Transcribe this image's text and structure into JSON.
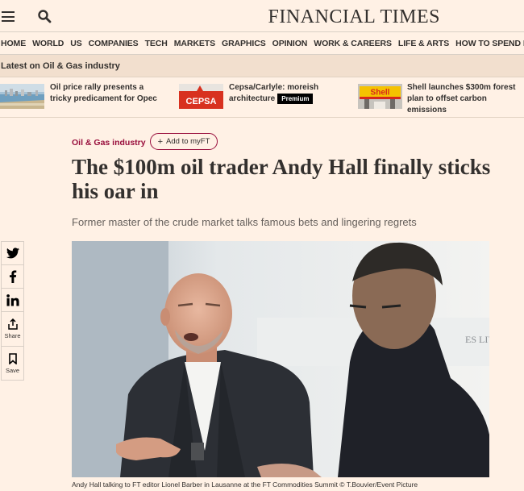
{
  "header": {
    "masthead": "FINANCIAL TIMES",
    "menu_icon": "menu-icon",
    "search_icon": "search-icon"
  },
  "nav": {
    "items": [
      "HOME",
      "WORLD",
      "US",
      "COMPANIES",
      "TECH",
      "MARKETS",
      "GRAPHICS",
      "OPINION",
      "WORK & CAREERS",
      "LIFE & ARTS",
      "HOW TO SPEND IT"
    ]
  },
  "topic_bar": {
    "title": "Latest on Oil & Gas industry"
  },
  "related": [
    {
      "title": "Oil price rally presents a tricky predicament for Opec",
      "premium": ""
    },
    {
      "title": "Cepsa/Carlyle: moreish architecture",
      "premium": "Premium",
      "thumb_text": "CEPSA"
    },
    {
      "title": "Shell launches $300m forest plan to offset carbon emissions",
      "premium": "",
      "thumb_text": "Shell"
    }
  ],
  "article": {
    "topic": "Oil & Gas industry",
    "myft_label": "Add to myFT",
    "headline": "The $100m oil trader Andy Hall finally sticks his oar in",
    "standfirst": "Former master of the crude market talks famous bets and lingering regrets",
    "caption": "Andy Hall talking to FT editor Lionel Barber in Lausanne at the FT Commodities Summit © T.Bouvier/Event Picture",
    "photo_backdrop_text": "ES LIVE"
  },
  "share": {
    "twitter_icon": "twitter-icon",
    "facebook_icon": "facebook-icon",
    "linkedin_icon": "linkedin-icon",
    "share_label": "Share",
    "save_label": "Save"
  },
  "colors": {
    "background": "#fff1e5",
    "topic_bar": "#f2dfce",
    "claret": "#990f3d",
    "text": "#33302e"
  }
}
